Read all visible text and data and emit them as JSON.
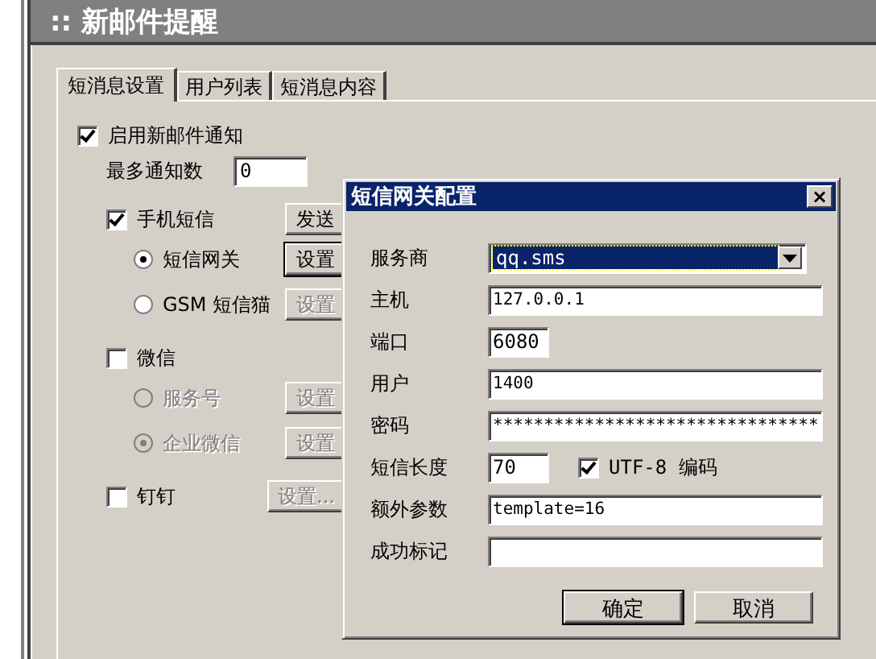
{
  "window": {
    "title": ":: 新邮件提醒"
  },
  "tabs": [
    {
      "label": "短消息设置",
      "selected": true
    },
    {
      "label": "用户列表",
      "selected": false
    },
    {
      "label": "短消息内容",
      "selected": false
    }
  ],
  "enable": {
    "label": "启用新邮件通知",
    "checked": true
  },
  "max_notify": {
    "label": "最多通知数",
    "value": "0"
  },
  "channels": [
    {
      "label": "手机短信",
      "checked": true,
      "button": {
        "label": "发送",
        "disabled": false
      },
      "children": [
        {
          "label": "短信网关",
          "selected": true,
          "disabled": false,
          "button": {
            "label": "设置",
            "disabled": false
          }
        },
        {
          "label": "GSM 短信猫",
          "selected": false,
          "disabled": false,
          "button": {
            "label": "设置",
            "disabled": true
          }
        }
      ]
    },
    {
      "label": "微信",
      "checked": false,
      "children": [
        {
          "label": "服务号",
          "selected": false,
          "disabled": true,
          "button": {
            "label": "设置",
            "disabled": true
          }
        },
        {
          "label": "企业微信",
          "selected": true,
          "disabled": true,
          "button": {
            "label": "设置",
            "disabled": true
          }
        }
      ]
    },
    {
      "label": "钉钉",
      "checked": false,
      "button": {
        "label": "设置...",
        "disabled": true
      }
    }
  ],
  "dialog": {
    "title": "短信网关配置",
    "close": "×",
    "fields": [
      {
        "label": "服务商",
        "kind": "select",
        "value": "qq.sms"
      },
      {
        "label": "主机",
        "kind": "text",
        "value": "127.0.0.1"
      },
      {
        "label": "端口",
        "kind": "short",
        "value": "6080"
      },
      {
        "label": "用户",
        "kind": "text",
        "value": "1400"
      },
      {
        "label": "密码",
        "kind": "text",
        "value": "********************************"
      },
      {
        "label": "短信长度",
        "kind": "short",
        "value": "70",
        "option": {
          "label": "UTF-8 编码",
          "checked": true
        }
      },
      {
        "label": "额外参数",
        "kind": "text",
        "value": "template=16"
      },
      {
        "label": "成功标记",
        "kind": "text"
      }
    ],
    "buttons": [
      "确定",
      "取消"
    ]
  }
}
